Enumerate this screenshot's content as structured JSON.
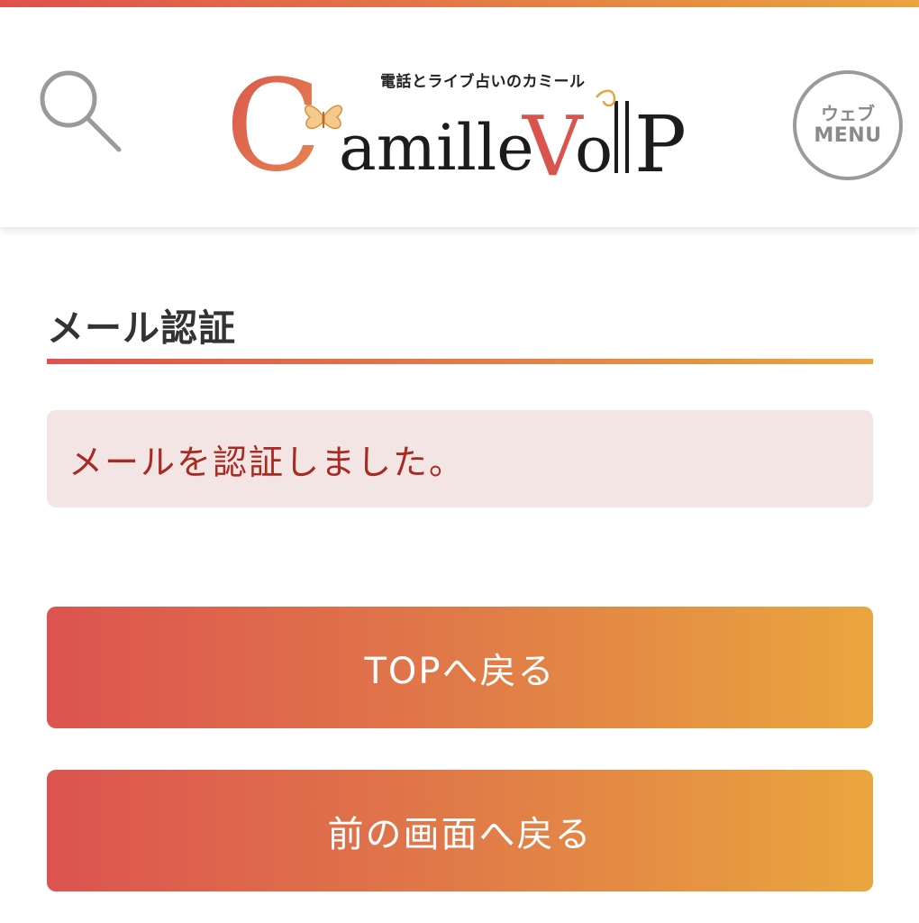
{
  "header": {
    "search_icon": "search-icon",
    "logo": {
      "tagline": "電話とライブ占いのカミール",
      "brand": "Camille VoIP"
    },
    "web_menu": {
      "line1": "ウェブ",
      "line2": "MENU"
    }
  },
  "main": {
    "title": "メール認証",
    "alert_message": "メールを認証しました。",
    "buttons": {
      "top": "TOPへ戻る",
      "back": "前の画面へ戻る"
    }
  },
  "colors": {
    "gradient_start": "#e0524e",
    "gradient_mid": "#e37a47",
    "gradient_end": "#eaa43f",
    "alert_bg": "#f4e5e5",
    "alert_text": "#a82a22",
    "title_text": "#333333"
  }
}
